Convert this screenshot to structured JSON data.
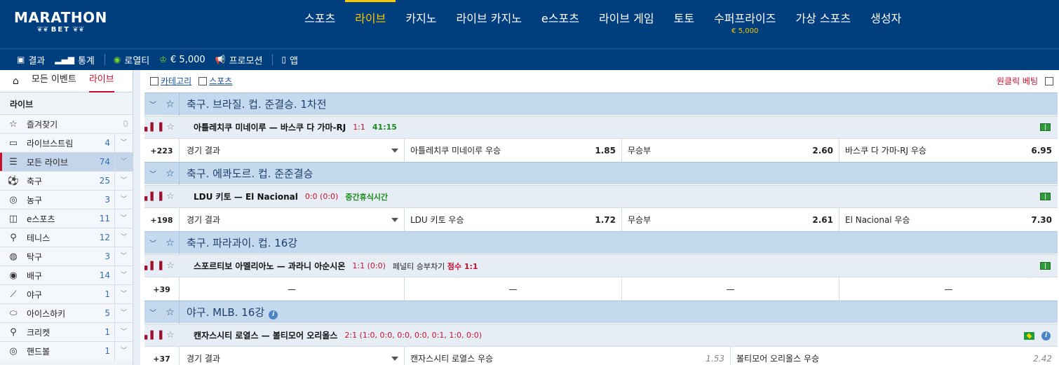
{
  "logo": {
    "line1": "MARATHON",
    "line2": "BET"
  },
  "nav": [
    {
      "label": "스포츠",
      "sub": ""
    },
    {
      "label": "라이브",
      "sub": ""
    },
    {
      "label": "카지노",
      "sub": ""
    },
    {
      "label": "라이브 카지노",
      "sub": ""
    },
    {
      "label": "e스포츠",
      "sub": ""
    },
    {
      "label": "라이브 게임",
      "sub": ""
    },
    {
      "label": "토토",
      "sub": ""
    },
    {
      "label": "수퍼프라이즈",
      "sub": "€ 5,000"
    },
    {
      "label": "가상 스포츠",
      "sub": ""
    },
    {
      "label": "생성자",
      "sub": ""
    }
  ],
  "active_nav": "라이브",
  "subbar": {
    "results": "결과",
    "stats": "통계",
    "loyalty": "로열티",
    "jackpot": "€ 5,000",
    "promo": "프로모션",
    "app": "앱"
  },
  "sidebar": {
    "tab_all": "모든 이벤트",
    "tab_live": "라이브",
    "heading": "라이브",
    "items": [
      {
        "label": "즐겨찾기",
        "count": "0",
        "icon": "star-icon",
        "glyph": "☆"
      },
      {
        "label": "라이브스트림",
        "count": "4",
        "icon": "tv-icon",
        "glyph": "▭"
      },
      {
        "label": "모든 라이브",
        "count": "74",
        "icon": "list-icon",
        "glyph": "☰"
      },
      {
        "label": "축구",
        "count": "25",
        "icon": "soccer-ball-icon",
        "glyph": "⚽"
      },
      {
        "label": "농구",
        "count": "3",
        "icon": "basketball-icon",
        "glyph": "◎"
      },
      {
        "label": "e스포츠",
        "count": "11",
        "icon": "gamepad-icon",
        "glyph": "◫"
      },
      {
        "label": "테니스",
        "count": "12",
        "icon": "tennis-racket-icon",
        "glyph": "⚲"
      },
      {
        "label": "탁구",
        "count": "3",
        "icon": "table-tennis-icon",
        "glyph": "◍"
      },
      {
        "label": "배구",
        "count": "14",
        "icon": "volleyball-icon",
        "glyph": "◉"
      },
      {
        "label": "야구",
        "count": "1",
        "icon": "baseball-bat-icon",
        "glyph": "⟋"
      },
      {
        "label": "아이스하키",
        "count": "5",
        "icon": "hockey-puck-icon",
        "glyph": "⬭"
      },
      {
        "label": "크리켓",
        "count": "1",
        "icon": "cricket-bat-icon",
        "glyph": "⚲"
      },
      {
        "label": "핸드볼",
        "count": "1",
        "icon": "handball-icon",
        "glyph": "◎"
      }
    ]
  },
  "filters": {
    "category": "카테고리",
    "sports": "스포츠",
    "one_click": "원클릭 베팅"
  },
  "events": [
    {
      "league": "축구. 브라질. 컵. 준결승. 1차전",
      "teams": "아틀레치쿠 미네이루 — 바스쿠 다 가마-RJ",
      "score": "1:1",
      "time": "41:15",
      "extra": "",
      "pen_score": "",
      "more": "+223",
      "market": "경기 결과",
      "odds": [
        {
          "label": "아틀레치쿠 미네이루 우승",
          "value": "1.85"
        },
        {
          "label": "무승부",
          "value": "2.60"
        },
        {
          "label": "바스쿠 다 가마-RJ 우승",
          "value": "6.95"
        }
      ]
    },
    {
      "league": "축구. 에콰도르. 컵. 준준결승",
      "teams": "LDU 키토 — El Nacional",
      "score": "0:0 (0:0)",
      "time": "중간휴식시간",
      "extra": "",
      "pen_score": "",
      "more": "+198",
      "market": "경기 결과",
      "odds": [
        {
          "label": "LDU 키토 우승",
          "value": "1.72"
        },
        {
          "label": "무승부",
          "value": "2.61"
        },
        {
          "label": "El Nacional 우승",
          "value": "7.30"
        }
      ]
    },
    {
      "league": "축구. 파라과이. 컵. 16강",
      "teams": "스포르티보 아멜리아노 — 과라니 아순시온",
      "score": "1:1 (0:0)",
      "time": "",
      "extra": "페널티 승부차기",
      "pen_score": "점수 1:1",
      "more": "+39",
      "market": "—",
      "odds": [
        {
          "label": "—",
          "value": ""
        },
        {
          "label": "—",
          "value": ""
        },
        {
          "label": "—",
          "value": ""
        }
      ]
    },
    {
      "league": "야구. MLB. 16강",
      "teams": "캔자스시티 로열스 — 볼티모어 오리올스",
      "score": "2:1 (1:0, 0:0, 0:0, 0:0, 0:1, 1:0, 0:0)",
      "time": "",
      "extra": "",
      "pen_score": "",
      "more": "+37",
      "market": "경기 결과",
      "odds": [
        {
          "label": "캔자스시티 로열스 우승",
          "value": "1.53"
        },
        {
          "label": "볼티모어 오리올스 우승",
          "value": "2.42"
        }
      ]
    }
  ],
  "colors": {
    "header": "#003e7e",
    "accent": "#f7c800",
    "live_red": "#c8102e",
    "league_bg": "#c4d8ee"
  }
}
